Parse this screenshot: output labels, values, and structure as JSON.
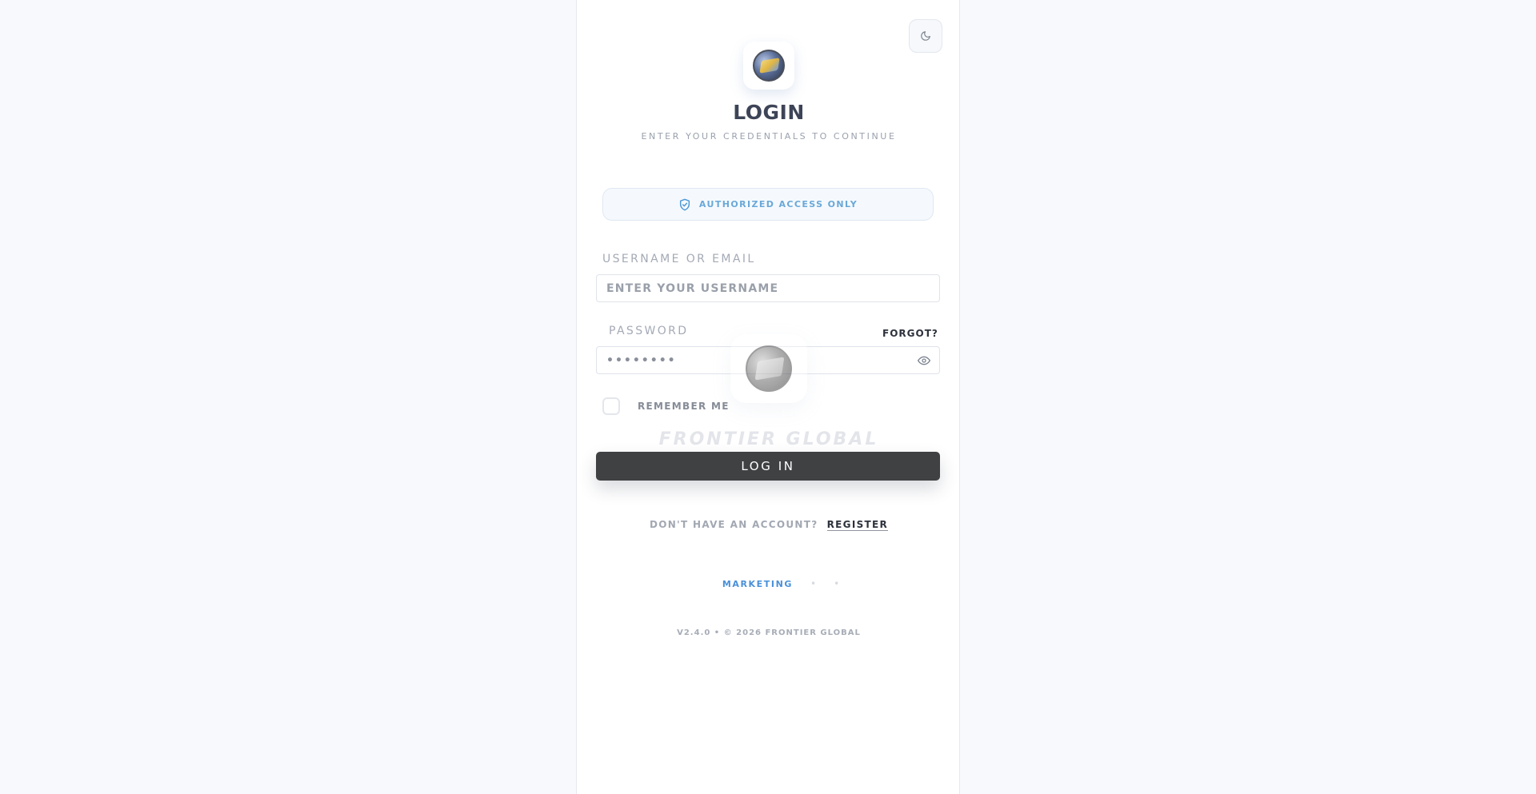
{
  "header": {
    "title": "LOGIN",
    "subtitle": "ENTER YOUR CREDENTIALS TO CONTINUE",
    "theme_toggle_icon": "moon-icon",
    "logo_icon": "company-logo"
  },
  "badge": {
    "icon": "shield-check-icon",
    "text": "AUTHORIZED ACCESS ONLY",
    "color": "#6aa8d8"
  },
  "form": {
    "username": {
      "label": "USERNAME OR EMAIL",
      "placeholder": "ENTER YOUR USERNAME",
      "value": ""
    },
    "password": {
      "label": "PASSWORD",
      "value": "••••••••",
      "forgot_label": "FORGOT?",
      "toggle_icon": "eye-icon"
    },
    "remember_label": "REMEMBER ME",
    "remember_checked": false,
    "submit_label": "LOG IN"
  },
  "watermark": {
    "text": "FRONTIER GLOBAL"
  },
  "account": {
    "question": "DON'T HAVE AN ACCOUNT?",
    "register_label": "REGISTER"
  },
  "footer": {
    "links": [
      "MARKETING",
      "•",
      "•"
    ],
    "version": "V2.4.0 • © 2026 FRONTIER GLOBAL"
  },
  "colors": {
    "background": "#f7f9fc",
    "panel": "#ffffff",
    "button": "#3f4143",
    "link_accent": "#4a90d9",
    "title": "#3d4457"
  }
}
